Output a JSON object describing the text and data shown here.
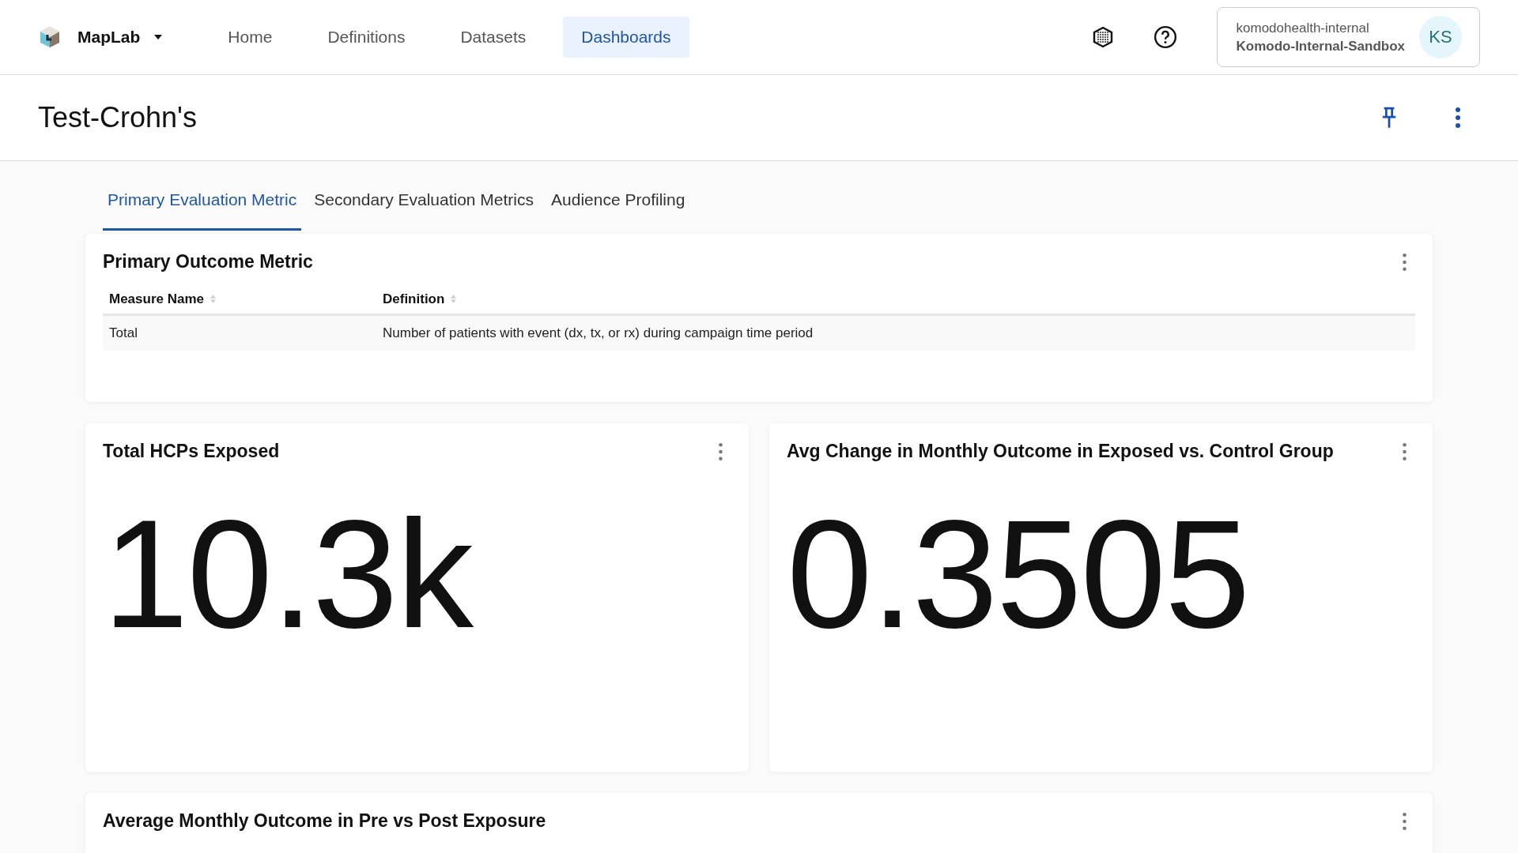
{
  "app": {
    "name": "MapLab"
  },
  "nav": [
    {
      "label": "Home",
      "selected": false
    },
    {
      "label": "Definitions",
      "selected": false
    },
    {
      "label": "Datasets",
      "selected": false
    },
    {
      "label": "Dashboards",
      "selected": true
    }
  ],
  "account": {
    "org": "komodohealth-internal",
    "workspace": "Komodo-Internal-Sandbox",
    "initials": "KS"
  },
  "page": {
    "title": "Test-Crohn's"
  },
  "tabs": [
    {
      "label": "Primary Evaluation Metric",
      "selected": true
    },
    {
      "label": "Secondary Evaluation Metrics",
      "selected": false
    },
    {
      "label": "Audience Profiling",
      "selected": false
    }
  ],
  "outcome_card": {
    "title": "Primary Outcome Metric",
    "columns": [
      "Measure Name",
      "Definition"
    ],
    "rows": [
      [
        "Total",
        "Number of patients with event (dx, tx, or rx) during campaign time period"
      ]
    ]
  },
  "stat_cards": [
    {
      "title": "Total HCPs Exposed",
      "value": "10.3k"
    },
    {
      "title": "Avg Change in Monthly Outcome in Exposed vs. Control Group",
      "value": "0.3505"
    }
  ],
  "bottom_card": {
    "title": "Average Monthly Outcome in Pre vs Post Exposure"
  }
}
